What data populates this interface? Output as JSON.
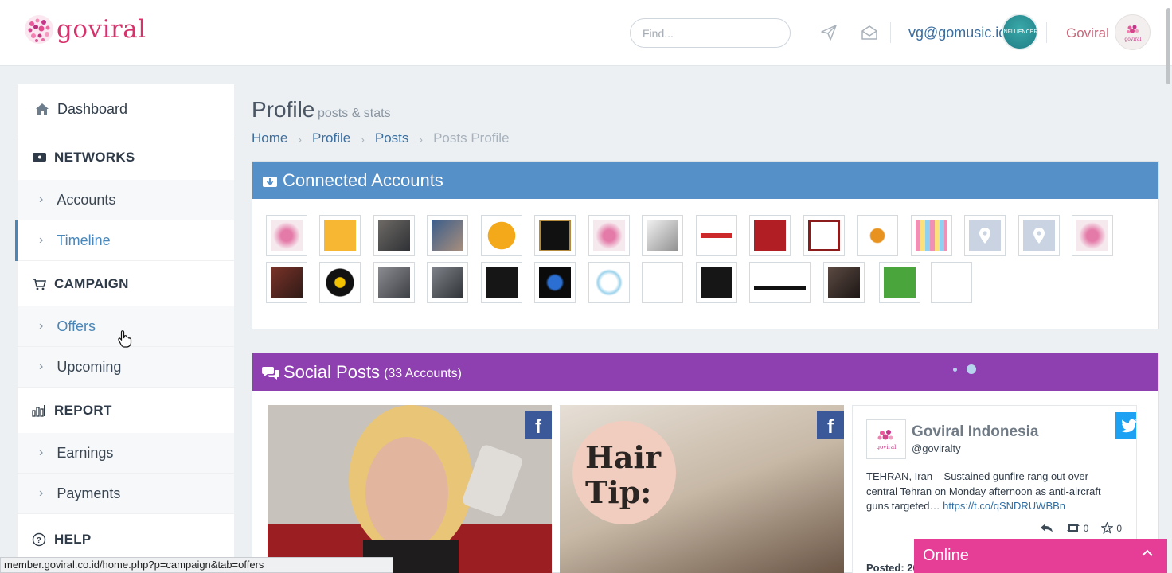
{
  "header": {
    "logo_text": "goviral",
    "search_placeholder": "Find...",
    "user_email": "vg@gomusic.id",
    "influencer_badge": "INFLUENCER",
    "brand_name": "Goviral",
    "brand_avatar_text": "goviral"
  },
  "sidebar": {
    "dashboard": "Dashboard",
    "networks": "NETWORKS",
    "accounts": "Accounts",
    "timeline": "Timeline",
    "campaign": "CAMPAIGN",
    "offers": "Offers",
    "upcoming": "Upcoming",
    "report": "REPORT",
    "earnings": "Earnings",
    "payments": "Payments",
    "help": "HELP"
  },
  "page": {
    "title": "Profile",
    "subtitle": "posts & stats",
    "breadcrumb": [
      "Home",
      "Profile",
      "Posts",
      "Posts Profile"
    ]
  },
  "connected": {
    "title": "Connected Accounts"
  },
  "social": {
    "title": "Social Posts",
    "count": "(33 Accounts)",
    "card2_text_line1": "Hair",
    "card2_text_line2": "Tip:",
    "tweet": {
      "name": "Goviral Indonesia",
      "handle": "@goviralty",
      "text": "TEHRAN, Iran – Sustained gunfire rang out over central Tehran on Monday afternoon as anti-aircraft guns targeted…",
      "link": "https://t.co/qSNDRUWBBn",
      "retweets": "0",
      "favorites": "0",
      "posted": "Posted: 20"
    }
  },
  "online": {
    "label": "Online"
  },
  "statusbar": {
    "url": "member.goviral.co.id/home.php?p=campaign&tab=offers"
  }
}
